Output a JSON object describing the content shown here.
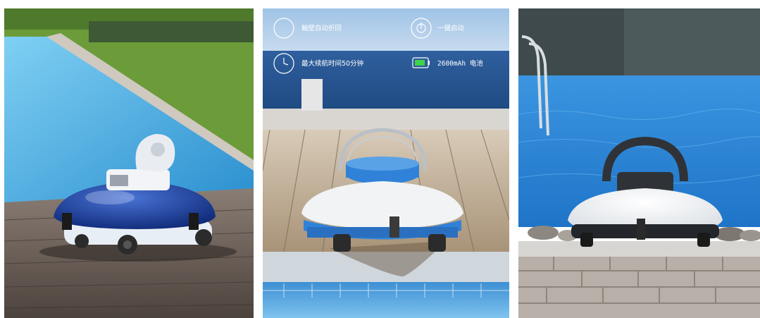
{
  "panels": [
    {
      "id": "photo-1",
      "scene": "robot pool cleaner on wooden deck beside pool",
      "colors": {
        "sky_grass": "#6e9a3c",
        "water": "#4bb0e0",
        "deck": "#6b5e56",
        "robot_shell": "#1d3f9e",
        "robot_base": "#e8eef5"
      }
    },
    {
      "id": "photo-2",
      "scene": "robot pool cleaner on wooden deck with sea background and feature icons",
      "colors": {
        "sky": "#8fb8dd",
        "sea": "#3b6fae",
        "deck": "#c9b9a3",
        "robot_top": "#2e7fd6",
        "robot_shell": "#f1f3f5"
      },
      "features": [
        {
          "icon": "wall-climb-icon",
          "text": "触壁自动折回"
        },
        {
          "icon": "power-icon",
          "text": "一键启动"
        },
        {
          "icon": "timer-icon",
          "text": "最大续航时间50分钟"
        },
        {
          "icon": "battery-icon",
          "text": "2600mAh 电池"
        }
      ]
    },
    {
      "id": "photo-3",
      "scene": "robot pool cleaner on stone pool edge",
      "colors": {
        "pool": "#2f8fe0",
        "stone": "#b9b2ad",
        "robot_top": "#2f3338",
        "robot_shell": "#eef1f4"
      }
    }
  ]
}
